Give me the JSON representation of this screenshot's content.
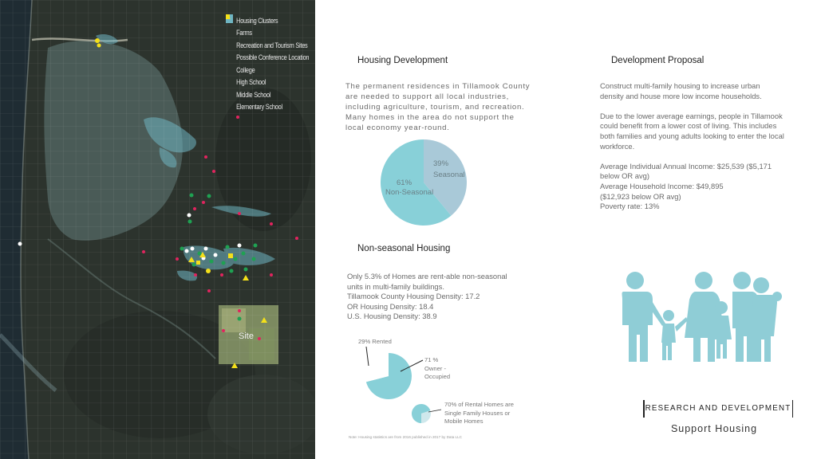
{
  "map": {
    "legend": [
      {
        "label": "Housing Clusters",
        "symbol": "square",
        "color": "#6fb5c2"
      },
      {
        "label": "Farms",
        "symbol": "dot",
        "color": "#e0245e"
      },
      {
        "label": "Recreation and Tourism Sites",
        "symbol": "dot",
        "color": "#1fa152"
      },
      {
        "label": "Possible Conference Location",
        "symbol": "dot",
        "color": "#ffffff"
      },
      {
        "label": "College",
        "symbol": "none",
        "color": ""
      },
      {
        "label": "High School",
        "symbol": "dot",
        "color": "#f4e01a"
      },
      {
        "label": "Middle School",
        "symbol": "square",
        "color": "#f4e01a"
      },
      {
        "label": "Elementary School",
        "symbol": "triangle",
        "color": "#f4e01a"
      }
    ],
    "site_label": "Site"
  },
  "housing_development": {
    "title": "Housing Development",
    "body_lines": [
      "The permanent residences in Tillamook County",
      "are needed to support all local industries,",
      "including agriculture, tourism, and recreation.",
      "Many homes in the area do not support the",
      "local economy year-round."
    ]
  },
  "development_proposal": {
    "title": "Development Proposal",
    "lines": [
      "Construct multi-family housing to increase urban",
      "density and house more low income households.",
      "",
      "Due to the lower average earnings, people in Tillamook",
      "could benefit from a lower cost of living. This includes",
      "both families and young adults looking to enter the local",
      "workforce.",
      "",
      "Average Individual Annual Income: $25,539 ($5,171",
      "below OR avg)",
      "Average Household Income: $49,895",
      "($12,923 below OR avg)",
      "Poverty rate: 13%"
    ]
  },
  "seasonal_pie": {
    "slices": [
      {
        "pct_label": "39%",
        "name": "Seasonal",
        "value": 39,
        "color": "#a9c9d8"
      },
      {
        "pct_label": "61%",
        "name": "Non-Seasonal",
        "value": 61,
        "color": "#88d0d8"
      }
    ]
  },
  "non_seasonal": {
    "title": "Non-seasonal Housing",
    "lines": [
      "Only 5.3% of Homes are rent-able non-seasonal",
      "units in multi-family buildings.",
      "Tillamook County Housing Density: 17.2",
      "OR Housing Density: 18.4",
      "U.S. Housing Density: 38.9"
    ]
  },
  "tenure_pie": {
    "rented_label": "29% Rented",
    "owner_lines": [
      "71 %",
      "Owner -",
      "Occupied"
    ],
    "rented_value": 29,
    "owner_value": 71,
    "color": "#88d0d8"
  },
  "rental_pie": {
    "lines": [
      "70% of Rental Homes are",
      "Single Family Houses or",
      "Mobile Homes"
    ],
    "value": 70,
    "color": "#88d0d8"
  },
  "note": "Note: Housing statistics are from 2016 published in 2017 by Data LLC",
  "footer": {
    "title": "RESEARCH AND DEVELOPMENT",
    "subtitle": "Support Housing"
  },
  "family_icon_color": "#8fcdd6"
}
